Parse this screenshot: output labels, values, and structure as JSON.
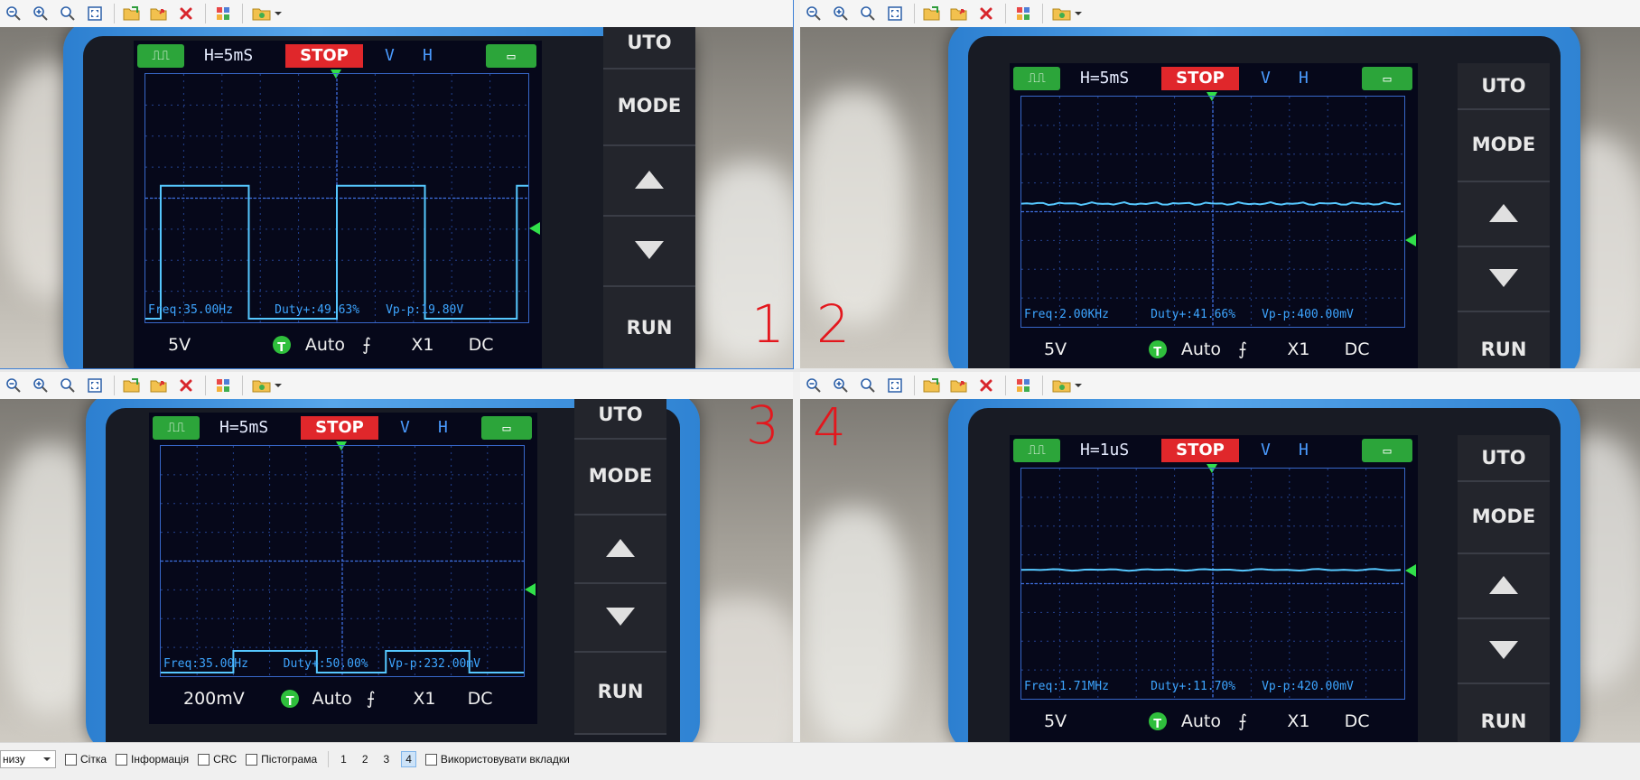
{
  "icons": {
    "zoom_out": "zoom-out-icon",
    "zoom_in": "zoom-in-icon",
    "zoom_actual": "zoom-actual-icon",
    "fit": "fit-window-icon",
    "open": "open-folder-icon",
    "save": "save-icon",
    "delete": "delete-icon",
    "grid": "grid-icon",
    "folder_menu": "folder-menu-icon"
  },
  "scope": {
    "mode_label": "MODE",
    "auto_label": "UTO",
    "run_label": "RUN",
    "stop_label": "STOP",
    "v_label": "V",
    "h_label": "H",
    "trigger_mode": "Auto",
    "probe": "X1",
    "coupling": "DC",
    "t_label": "T"
  },
  "panes": [
    {
      "id": 1,
      "timebase": "H=5mS",
      "volts": "5V",
      "freq": "Freq:35.00Hz",
      "duty": "Duty+:49.63%",
      "vpp": "Vp-p:19.80V",
      "mark": "1"
    },
    {
      "id": 2,
      "timebase": "H=5mS",
      "volts": "5V",
      "freq": "Freq:2.00KHz",
      "duty": "Duty+:41.66%",
      "vpp": "Vp-p:400.00mV",
      "mark": "2"
    },
    {
      "id": 3,
      "timebase": "H=5mS",
      "volts": "200mV",
      "freq": "Freq:35.00Hz",
      "duty": "Duty+:50.00%",
      "vpp": "Vp-p:232.00mV",
      "mark": "3"
    },
    {
      "id": 4,
      "timebase": "H=1uS",
      "volts": "5V",
      "freq": "Freq:1.71MHz",
      "duty": "Duty+:11.70%",
      "vpp": "Vp-p:420.00mV",
      "mark": "4"
    }
  ],
  "statusbar": {
    "layout_select": "низу",
    "checkboxes": [
      "Сітка",
      "Інформація",
      "CRC",
      "Пістограма"
    ],
    "pages": [
      "1",
      "2",
      "3",
      "4"
    ],
    "current_page": "4",
    "tabs_checkbox": "Використовувати вкладки"
  },
  "colors": {
    "accent": "#3c7fd6",
    "trace": "#56c8ff",
    "stop": "#e0272b",
    "green": "#2ca53a",
    "mark": "#e3171d"
  }
}
